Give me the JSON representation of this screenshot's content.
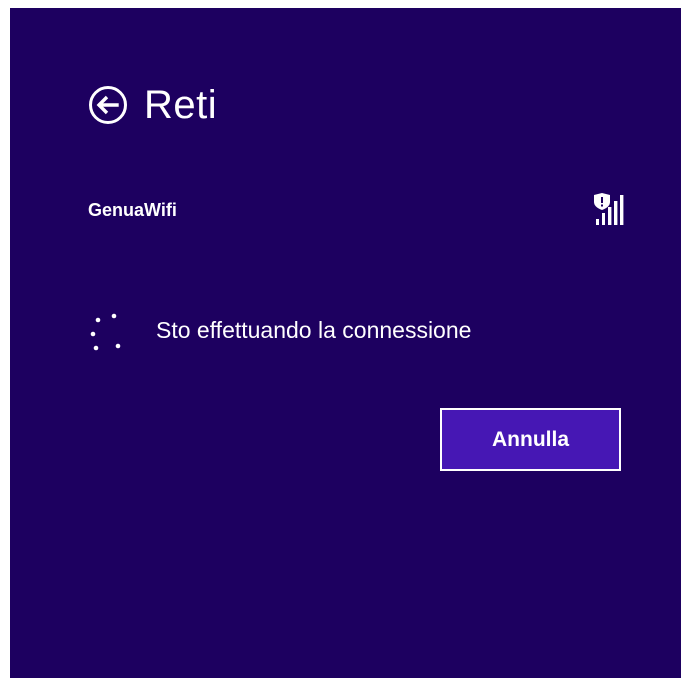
{
  "panel": {
    "title": "Reti",
    "back_icon": "back-arrow-circle-icon"
  },
  "network": {
    "name": "GenuaWifi",
    "signal_icon": "wifi-signal-secured-icon",
    "signal_level": 1.0
  },
  "status": {
    "spinner_icon": "loading-spinner-icon",
    "text": "Sto effettuando la connessione"
  },
  "actions": {
    "cancel_label": "Annulla"
  },
  "colors": {
    "background": "#1d0060",
    "button": "#4617b4",
    "text": "#ffffff"
  }
}
